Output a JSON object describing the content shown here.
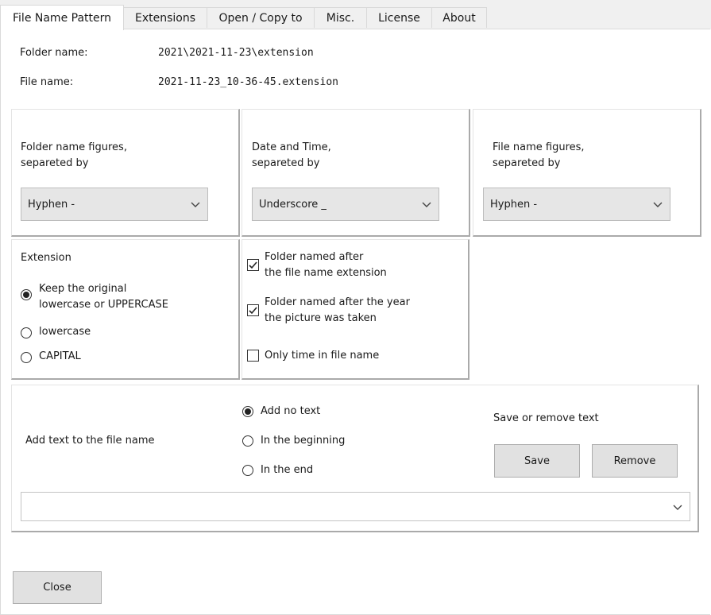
{
  "tabs": [
    "File Name Pattern",
    "Extensions",
    "Open / Copy to",
    "Misc.",
    "License",
    "About"
  ],
  "preview": {
    "folder_label": "Folder name:",
    "folder_value": "2021\\2021-11-23\\extension",
    "file_label": "File name:",
    "file_value": "2021-11-23_10-36-45.extension"
  },
  "folder_figures": {
    "line1": "Folder name figures,",
    "line2": "separeted by",
    "value": "Hyphen -"
  },
  "date_time": {
    "line1": "Date and Time,",
    "line2": "separeted by",
    "value": "Underscore _"
  },
  "file_figures": {
    "line1": "File name figures,",
    "line2": "separeted by",
    "value": "Hyphen -"
  },
  "extension": {
    "title": "Extension",
    "keep_line1": "Keep the original",
    "keep_line2": "lowercase or UPPERCASE",
    "lower": "lowercase",
    "capital": "CAPITAL",
    "selected": "keep"
  },
  "options": {
    "folder_ext_line1": "Folder named after",
    "folder_ext_line2": "the file name extension",
    "folder_year_line1": "Folder named after the year",
    "folder_year_line2": "the picture was taken",
    "only_time": "Only time in file name",
    "folder_ext_checked": true,
    "folder_year_checked": true,
    "only_time_checked": false
  },
  "add_text": {
    "label": "Add text to the file name",
    "opt_none": "Add no text",
    "opt_begin": "In the beginning",
    "opt_end": "In the end",
    "selected": "none",
    "save_remove_label": "Save or remove text",
    "save": "Save",
    "remove": "Remove",
    "combo_value": ""
  },
  "close": "Close"
}
